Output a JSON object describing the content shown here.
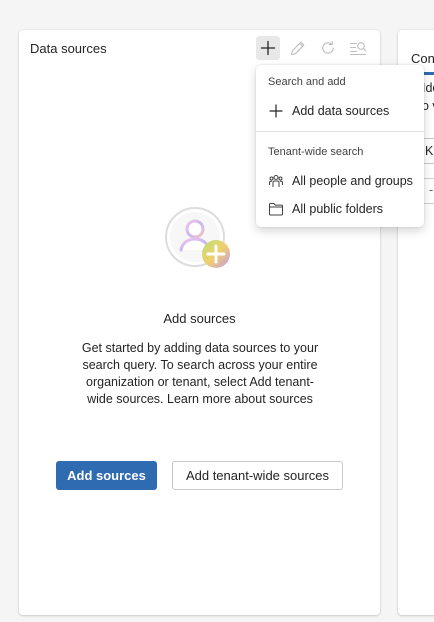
{
  "left_panel": {
    "title": "Data sources",
    "toolbar": {
      "add_icon": "plus-icon",
      "edit_icon": "pencil-icon",
      "refresh_icon": "refresh-icon",
      "filter_icon": "search-filter-icon"
    },
    "empty_state": {
      "illustration": "add-person-illustration",
      "title": "Add sources",
      "description": "Get started by adding data sources to your search query. To search across your entire organization or tenant, select Add tenant-wide sources. Learn more about sources"
    },
    "buttons": {
      "primary": "Add sources",
      "secondary": "Add tenant-wide sources"
    }
  },
  "menu": {
    "section1_header": "Search and add",
    "add_data_sources": "Add data sources",
    "section2_header": "Tenant-wide search",
    "all_people": "All people and groups",
    "all_folders": "All public folders"
  },
  "right_panel": {
    "tab_label": "Con",
    "text_line1": "Ide",
    "text_line2": "o v",
    "input_value": "K",
    "select_value": "-"
  },
  "colors": {
    "accent": "#2f6bb1",
    "panel_bg": "#ffffff",
    "page_bg": "#f5f5f5"
  }
}
